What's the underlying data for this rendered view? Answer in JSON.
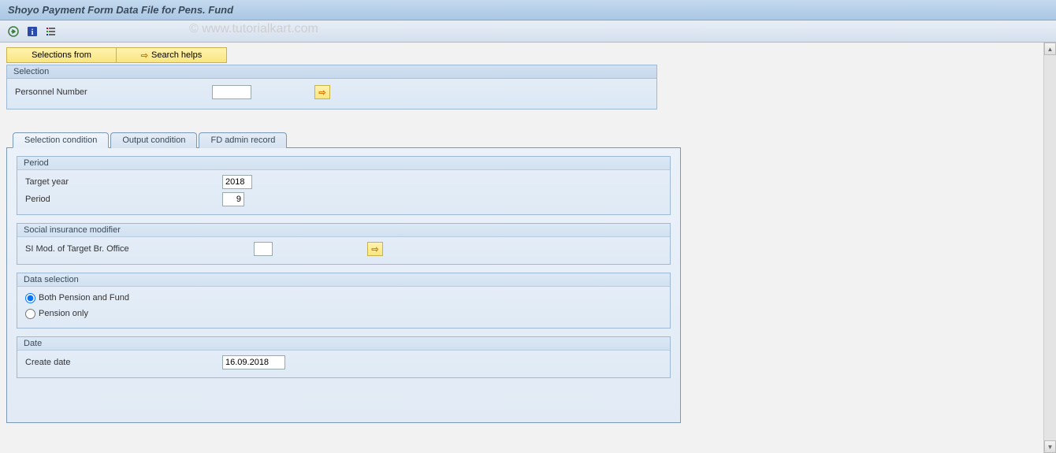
{
  "title": "Shoyo Payment Form Data File for Pens. Fund",
  "watermark": "© www.tutorialkart.com",
  "toolbar_buttons": {
    "selections_from": "Selections from",
    "search_helps": "Search helps"
  },
  "selection_group": {
    "title": "Selection",
    "personnel_number_label": "Personnel Number",
    "personnel_number_value": ""
  },
  "tabs": [
    {
      "id": "selection_condition",
      "label": "Selection condition",
      "active": true
    },
    {
      "id": "output_condition",
      "label": "Output condition",
      "active": false
    },
    {
      "id": "fd_admin_record",
      "label": "FD admin record",
      "active": false
    }
  ],
  "period_group": {
    "title": "Period",
    "target_year_label": "Target year",
    "target_year_value": "2018",
    "period_label": "Period",
    "period_value": "9"
  },
  "si_group": {
    "title": "Social insurance modifier",
    "si_mod_label": "SI Mod. of Target Br. Office",
    "si_mod_value": ""
  },
  "data_selection_group": {
    "title": "Data selection",
    "option_both": "Both Pension and Fund",
    "option_pension": "Pension only",
    "selected": "both"
  },
  "date_group": {
    "title": "Date",
    "create_date_label": "Create date",
    "create_date_value": "16.09.2018"
  }
}
